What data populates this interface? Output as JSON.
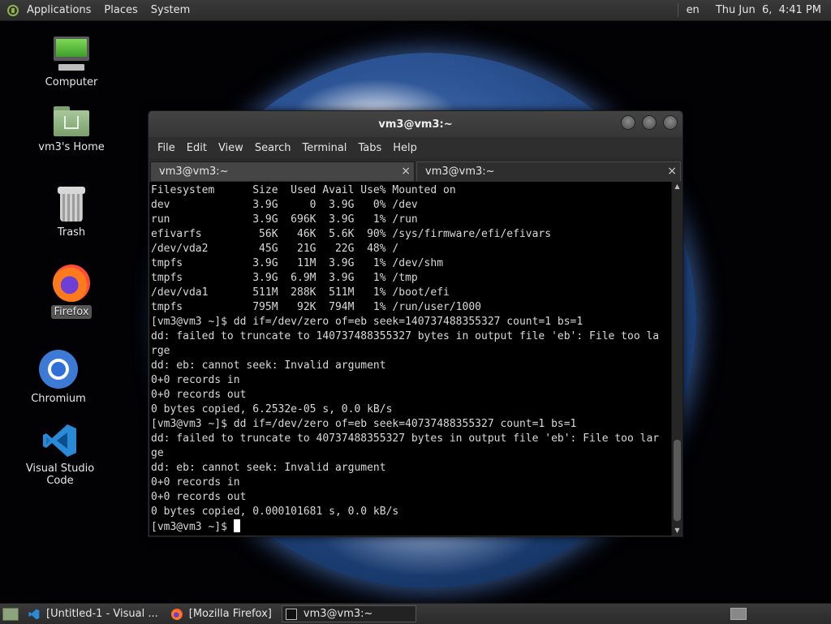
{
  "top_panel": {
    "menus": [
      "Applications",
      "Places",
      "System"
    ],
    "language": "en",
    "clock": "Thu Jun  6,  4:41 PM"
  },
  "desktop_icons": [
    {
      "label": "Computer",
      "icon": "computer-icon"
    },
    {
      "label": "vm3's Home",
      "icon": "home-folder-icon"
    },
    {
      "label": "Trash",
      "icon": "trash-icon"
    },
    {
      "label": "Firefox",
      "icon": "firefox-icon"
    },
    {
      "label": "Chromium",
      "icon": "chromium-icon"
    },
    {
      "label": "Visual Studio Code",
      "icon": "vscode-icon"
    }
  ],
  "terminal": {
    "title": "vm3@vm3:~",
    "menu": [
      "File",
      "Edit",
      "View",
      "Search",
      "Terminal",
      "Tabs",
      "Help"
    ],
    "tabs": [
      {
        "label": "vm3@vm3:~",
        "close": "×",
        "active": false
      },
      {
        "label": "vm3@vm3:~",
        "close": "×",
        "active": true
      }
    ],
    "lines": [
      "Filesystem      Size  Used Avail Use% Mounted on",
      "dev             3.9G     0  3.9G   0% /dev",
      "run             3.9G  696K  3.9G   1% /run",
      "efivarfs         56K   46K  5.6K  90% /sys/firmware/efi/efivars",
      "/dev/vda2        45G   21G   22G  48% /",
      "tmpfs           3.9G   11M  3.9G   1% /dev/shm",
      "tmpfs           3.9G  6.9M  3.9G   1% /tmp",
      "/dev/vda1       511M  288K  511M   1% /boot/efi",
      "tmpfs           795M   92K  794M   1% /run/user/1000",
      "[vm3@vm3 ~]$ dd if=/dev/zero of=eb seek=140737488355327 count=1 bs=1",
      "dd: failed to truncate to 140737488355327 bytes in output file 'eb': File too la",
      "rge",
      "dd: eb: cannot seek: Invalid argument",
      "0+0 records in",
      "0+0 records out",
      "0 bytes copied, 6.2532e-05 s, 0.0 kB/s",
      "[vm3@vm3 ~]$ dd if=/dev/zero of=eb seek=40737488355327 count=1 bs=1",
      "dd: failed to truncate to 40737488355327 bytes in output file 'eb': File too lar",
      "ge",
      "dd: eb: cannot seek: Invalid argument",
      "0+0 records in",
      "0+0 records out",
      "0 bytes copied, 0.000101681 s, 0.0 kB/s"
    ],
    "prompt": "[vm3@vm3 ~]$ "
  },
  "taskbar": {
    "items": [
      {
        "label": "[Untitled-1 - Visual ...",
        "icon": "vscode-icon",
        "active": false
      },
      {
        "label": "[Mozilla Firefox]",
        "icon": "firefox-icon",
        "active": false
      },
      {
        "label": "vm3@vm3:~",
        "icon": "terminal-icon",
        "active": true
      }
    ]
  },
  "colors": {
    "panel": "#2f2f2f",
    "terminal_bg": "#000000",
    "terminal_fg": "#d9d9d9"
  }
}
